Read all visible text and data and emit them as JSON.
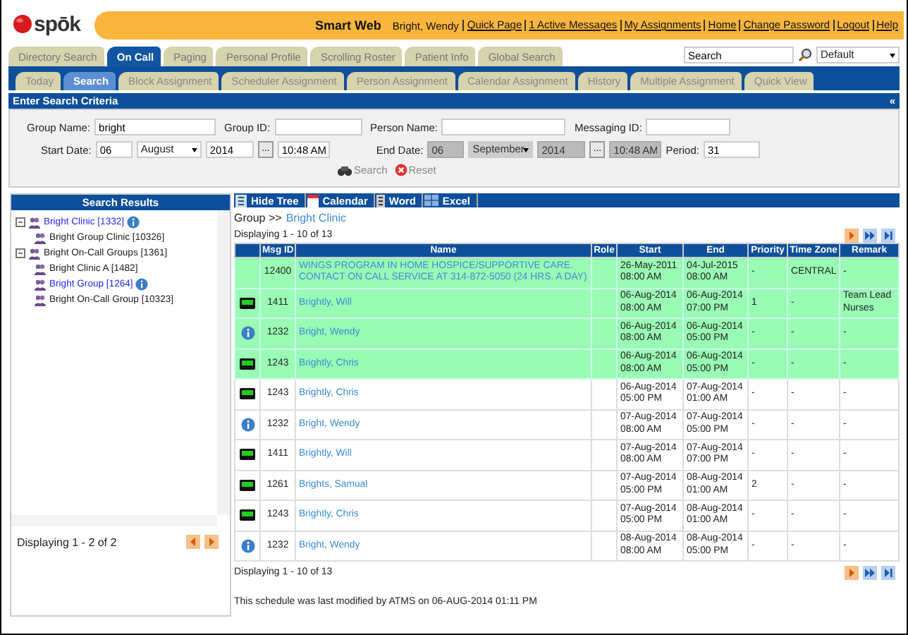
{
  "header": {
    "logo": "spōk",
    "app_title": "Smart Web",
    "user": "Bright, Wendy",
    "links": [
      "Quick Page",
      "1 Active Messages",
      "My Assignments",
      "Home",
      "Change Password",
      "Logout",
      "Help"
    ]
  },
  "main_tabs": [
    {
      "label": "Directory Search",
      "selected": false
    },
    {
      "label": "On Call",
      "selected": true
    },
    {
      "label": "Paging",
      "selected": false
    },
    {
      "label": "Personal Profile",
      "selected": false
    },
    {
      "label": "Scrolling Roster",
      "selected": false
    },
    {
      "label": "Patient Info",
      "selected": false
    },
    {
      "label": "Global Search",
      "selected": false
    }
  ],
  "search_box": {
    "value": "Search"
  },
  "profile_select": {
    "value": "Default"
  },
  "sub_tabs": [
    {
      "label": "Today",
      "selected": false
    },
    {
      "label": "Search",
      "selected": true
    },
    {
      "label": "Block Assignment",
      "selected": false
    },
    {
      "label": "Scheduler Assignment",
      "selected": false
    },
    {
      "label": "Person Assignment",
      "selected": false
    },
    {
      "label": "Calendar Assignment",
      "selected": false
    },
    {
      "label": "History",
      "selected": false
    },
    {
      "label": "Multiple Assignment",
      "selected": false
    },
    {
      "label": "Quick View",
      "selected": false
    }
  ],
  "criteria": {
    "title": "Enter Search Criteria",
    "collapse": "«",
    "fields": [
      {
        "label": "Group Name:",
        "value": "bright"
      },
      {
        "label": "Group ID:"
      },
      {
        "label": "Person Name:"
      },
      {
        "label": "Messaging ID:"
      }
    ],
    "start": {
      "label": "Start Date:",
      "day": "06",
      "month": "August",
      "year": "2014",
      "picker": "...",
      "time": "10:48 AM",
      "disabled": false
    },
    "end": {
      "label": "End Date:",
      "day": "06",
      "month": "September",
      "year": "2014",
      "picker": "...",
      "time": "10:48 AM",
      "disabled": true
    },
    "period": {
      "label": "Period:",
      "value": "31"
    },
    "buttons": [
      {
        "kind": "search",
        "label": "Search"
      },
      {
        "kind": "reset",
        "label": "Reset"
      }
    ]
  },
  "results": {
    "title": "Search Results",
    "tree": [
      {
        "label": "Bright Clinic [1332]",
        "linked": true,
        "info": true,
        "expanded": true,
        "children": [
          {
            "label": "Bright Group Clinic [10326]",
            "linked": false,
            "info": false
          }
        ]
      },
      {
        "label": "Bright On-Call Groups [1361]",
        "linked": false,
        "info": false,
        "expanded": true,
        "children": [
          {
            "label": "Bright Clinic A [1482]",
            "linked": false,
            "info": false
          },
          {
            "label": "Bright Group [1264]",
            "linked": true,
            "info": true
          },
          {
            "label": "Bright On-Call Group [10323]",
            "linked": false,
            "info": false
          }
        ]
      }
    ],
    "status": "Displaying 1 - 2 of 2"
  },
  "toolbar": [
    {
      "kind": "tree",
      "label": "Hide Tree"
    },
    {
      "kind": "calendar",
      "label": "Calendar"
    },
    {
      "kind": "word",
      "label": "Word"
    },
    {
      "kind": "excel",
      "label": "Excel"
    }
  ],
  "breadcrumb": {
    "prefix": "Group >>",
    "link": "Bright Clinic"
  },
  "status_top": "Displaying 1 - 10 of 13",
  "table": {
    "columns": [
      "",
      "Msg ID",
      "Name",
      "Role",
      "Start",
      "End",
      "Priority",
      "Time Zone",
      "Remark"
    ],
    "rows": [
      {
        "kind": "none",
        "highlighted": true,
        "msg_id": "12400",
        "name": "WINGS PROGRAM IN HOME HOSPICE/SUPPORTIVE CARE. CONTACT ON CALL SERVICE AT 314-872-5050 (24 HRS. A DAY)",
        "start_date": "26-May-2011",
        "start_time": "08:00 AM",
        "end_date": "04-Jul-2015",
        "end_time": "08:00 AM",
        "priority": "-",
        "time_zone": "CENTRAL",
        "remark": "-"
      },
      {
        "kind": "device",
        "highlighted": true,
        "msg_id": "1411",
        "name": "Brightly, Will",
        "start_date": "06-Aug-2014",
        "start_time": "08:00 AM",
        "end_date": "06-Aug-2014",
        "end_time": "07:00 PM",
        "priority": "1",
        "time_zone": "-",
        "remark": "Team Lead Nurses"
      },
      {
        "kind": "info",
        "highlighted": true,
        "msg_id": "1232",
        "name": "Bright, Wendy",
        "start_date": "06-Aug-2014",
        "start_time": "08:00 AM",
        "end_date": "06-Aug-2014",
        "end_time": "05:00 PM",
        "priority": "-",
        "time_zone": "-",
        "remark": "-"
      },
      {
        "kind": "device",
        "highlighted": true,
        "msg_id": "1243",
        "name": "Brightly, Chris",
        "start_date": "06-Aug-2014",
        "start_time": "08:00 AM",
        "end_date": "06-Aug-2014",
        "end_time": "05:00 PM",
        "priority": "-",
        "time_zone": "-",
        "remark": "-"
      },
      {
        "kind": "device",
        "highlighted": false,
        "msg_id": "1243",
        "name": "Brightly, Chris",
        "start_date": "06-Aug-2014",
        "start_time": "05:00 PM",
        "end_date": "07-Aug-2014",
        "end_time": "01:00 AM",
        "priority": "-",
        "time_zone": "-",
        "remark": "-"
      },
      {
        "kind": "info",
        "highlighted": false,
        "msg_id": "1232",
        "name": "Bright, Wendy",
        "start_date": "07-Aug-2014",
        "start_time": "08:00 AM",
        "end_date": "07-Aug-2014",
        "end_time": "05:00 PM",
        "priority": "-",
        "time_zone": "-",
        "remark": "-"
      },
      {
        "kind": "device",
        "highlighted": false,
        "msg_id": "1411",
        "name": "Brightly, Will",
        "start_date": "07-Aug-2014",
        "start_time": "08:00 AM",
        "end_date": "07-Aug-2014",
        "end_time": "07:00 PM",
        "priority": "-",
        "time_zone": "-",
        "remark": "-"
      },
      {
        "kind": "device",
        "highlighted": false,
        "msg_id": "1261",
        "name": "Brights, Samual",
        "start_date": "07-Aug-2014",
        "start_time": "05:00 PM",
        "end_date": "08-Aug-2014",
        "end_time": "01:00 AM",
        "priority": "2",
        "time_zone": "-",
        "remark": "-"
      },
      {
        "kind": "device",
        "highlighted": false,
        "msg_id": "1243",
        "name": "Brightly, Chris",
        "start_date": "07-Aug-2014",
        "start_time": "05:00 PM",
        "end_date": "08-Aug-2014",
        "end_time": "01:00 AM",
        "priority": "-",
        "time_zone": "-",
        "remark": "-"
      },
      {
        "kind": "info",
        "highlighted": false,
        "msg_id": "1232",
        "name": "Bright, Wendy",
        "start_date": "08-Aug-2014",
        "start_time": "08:00 AM",
        "end_date": "08-Aug-2014",
        "end_time": "05:00 PM",
        "priority": "-",
        "time_zone": "-",
        "remark": "-"
      }
    ]
  },
  "status_bottom": "Displaying 1 - 10 of 13",
  "footer": "This schedule was last modified by ATMS on 06-AUG-2014 01:11 PM"
}
